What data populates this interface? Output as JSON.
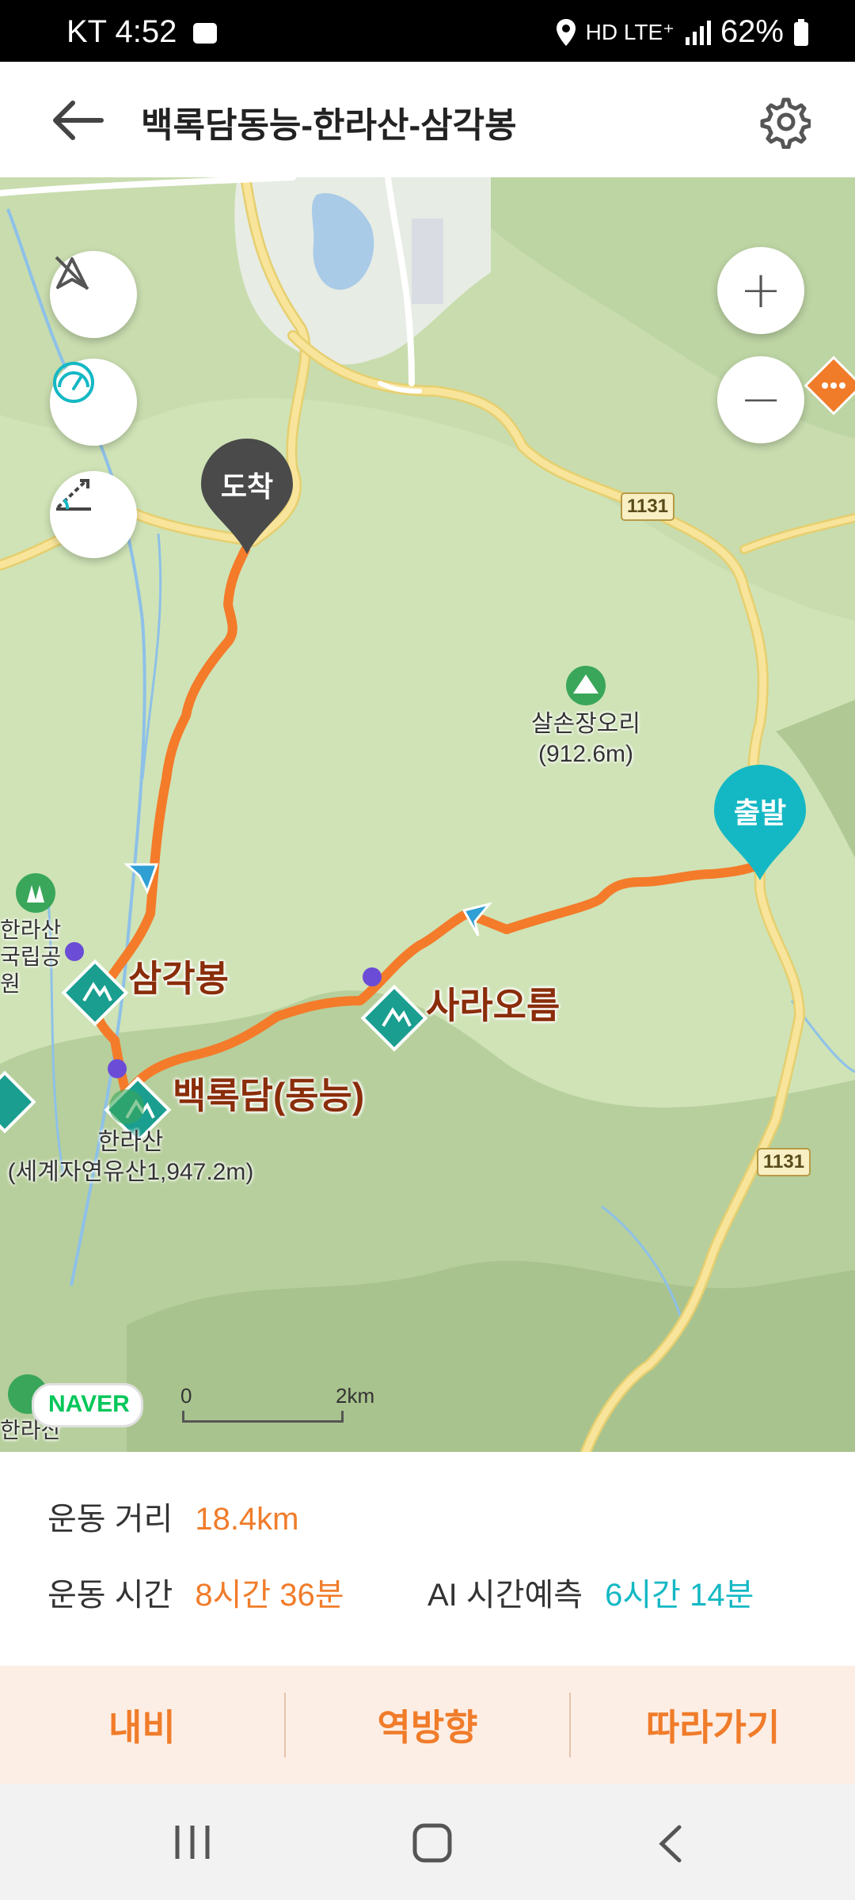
{
  "status_bar": {
    "carrier_time": "KT 4:52",
    "network": "HD LTE⁺",
    "battery": "62%"
  },
  "header": {
    "title": "백록담동능-한라산-삼각봉",
    "back_icon": "arrow-left-icon",
    "settings_icon": "gear-icon"
  },
  "map": {
    "controls": {
      "left": [
        "compass-off-icon",
        "speedometer-icon",
        "slope-icon"
      ],
      "zoom_in": "+",
      "zoom_out": "−"
    },
    "pins": {
      "end": "도착",
      "start": "출발"
    },
    "route_color": "#f47b2a",
    "start_pin_color": "#14b8c4",
    "end_pin_color": "#4a4a4a",
    "peaks": [
      {
        "name": "삼각봉"
      },
      {
        "name": "사라오름"
      },
      {
        "name": "백록담(동능)"
      }
    ],
    "pois": [
      {
        "name": "살손장오리",
        "detail": "(912.6m)"
      },
      {
        "name": "한라산",
        "detail": "(세계자연유산1,947.2m)"
      },
      {
        "name": "한라산",
        "detail": "국립공원"
      },
      {
        "name": "한라산",
        "detail": "공"
      }
    ],
    "road_labels": [
      "1131",
      "1131"
    ],
    "brand": "NAVER",
    "scale": {
      "start": "0",
      "end": "2km"
    }
  },
  "summary": {
    "distance_label": "운동 거리",
    "distance_value": "18.4km",
    "time_label": "운동 시간",
    "time_value": "8시간 36분",
    "ai_label": "AI 시간예측",
    "ai_value": "6시간 14분",
    "accent": "#f07c2a",
    "ai_accent": "#14b8c4"
  },
  "actions": [
    "내비",
    "역방향",
    "따라가기"
  ],
  "system_nav": [
    "recent-apps-icon",
    "home-icon",
    "back-icon"
  ]
}
